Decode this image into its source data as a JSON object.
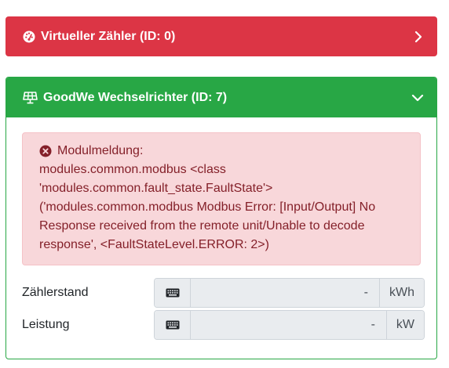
{
  "card_virtual": {
    "title": "Virtueller Zähler (ID: 0)",
    "color": "#dc3545",
    "icon": "gauge-icon"
  },
  "card_goodwe": {
    "title": "GoodWe Wechselrichter (ID: 7)",
    "color": "#28a745",
    "icon": "solar-panel-icon",
    "alert": {
      "icon": "error-circle-icon",
      "heading": "Modulmeldung:",
      "lines": [
        "modules.common.modbus <class",
        "'modules.common.fault_state.FaultState'>",
        "('modules.common.modbus Modbus Error: [Input/Output] No",
        "Response received from the remote unit/Unable to decode",
        "response', <FaultStateLevel.ERROR: 2>)"
      ]
    },
    "fields": [
      {
        "label": "Zählerstand",
        "value": "-",
        "unit": "kWh",
        "icon": "keyboard-icon"
      },
      {
        "label": "Leistung",
        "value": "-",
        "unit": "kW",
        "icon": "keyboard-icon"
      }
    ]
  }
}
